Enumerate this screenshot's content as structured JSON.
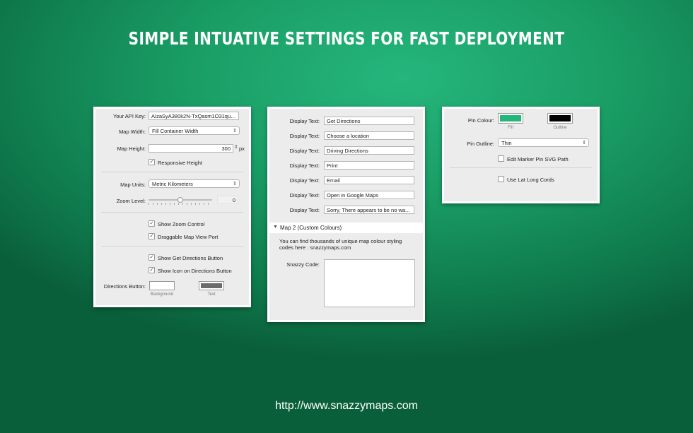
{
  "headline": "SIMPLE INTUATIVE SETTINGS FOR FAST DEPLOYMENT",
  "footer": "http://www.snazzymaps.com",
  "panel1": {
    "api_key_label": "Your API Key:",
    "api_key_value": "AIzaSyA380k2N-TxQasm1O31quP...",
    "map_width_label": "Map Width:",
    "map_width_value": "Fill Container Width",
    "map_height_label": "Map Height:",
    "map_height_value": "300",
    "map_height_unit": "px",
    "responsive_height": "Responsive Height",
    "map_units_label": "Map Units:",
    "map_units_value": "Metric Kilometers",
    "zoom_label": "Zoom Level:",
    "zoom_value": "0",
    "zoom_slider_fraction": 0.5,
    "show_zoom": "Show Zoom Control",
    "draggable": "Draggable Map View Port",
    "show_directions": "Show Get Directions Button",
    "show_icon": "Show Icon on Directions Button",
    "directions_button_label": "Directions Button:",
    "background_caption": "Background",
    "text_caption": "Text",
    "background_color": "#ffffff",
    "text_color": "#6b6b6b",
    "check_glyph": "✓"
  },
  "panel2": {
    "display_label": "Display Text:",
    "display_values": [
      "Get Directions",
      "Choose a location",
      "Driving Directions",
      "Print",
      "Email",
      "Open in Google Maps",
      "Sorry, There appears to be no wa..."
    ],
    "section_title": "Map 2 (Custom Colours)",
    "section_arrow": "▼",
    "info_line1": "You can find thousands of unique map colour styling",
    "info_line2": "codes here : snazzymaps.com",
    "snazzy_label": "Snazzy Code:"
  },
  "panel3": {
    "pin_colour_label": "Pin Colour:",
    "fill_caption": "Fill",
    "outline_caption": "Outline",
    "fill_color": "#25b67c",
    "outline_color": "#000000",
    "pin_outline_label": "Pin Outline:",
    "pin_outline_value": "Thin",
    "edit_svg": "Edit Marker Pin SVG Path",
    "lat_long": "Use Lat Long Cords"
  }
}
